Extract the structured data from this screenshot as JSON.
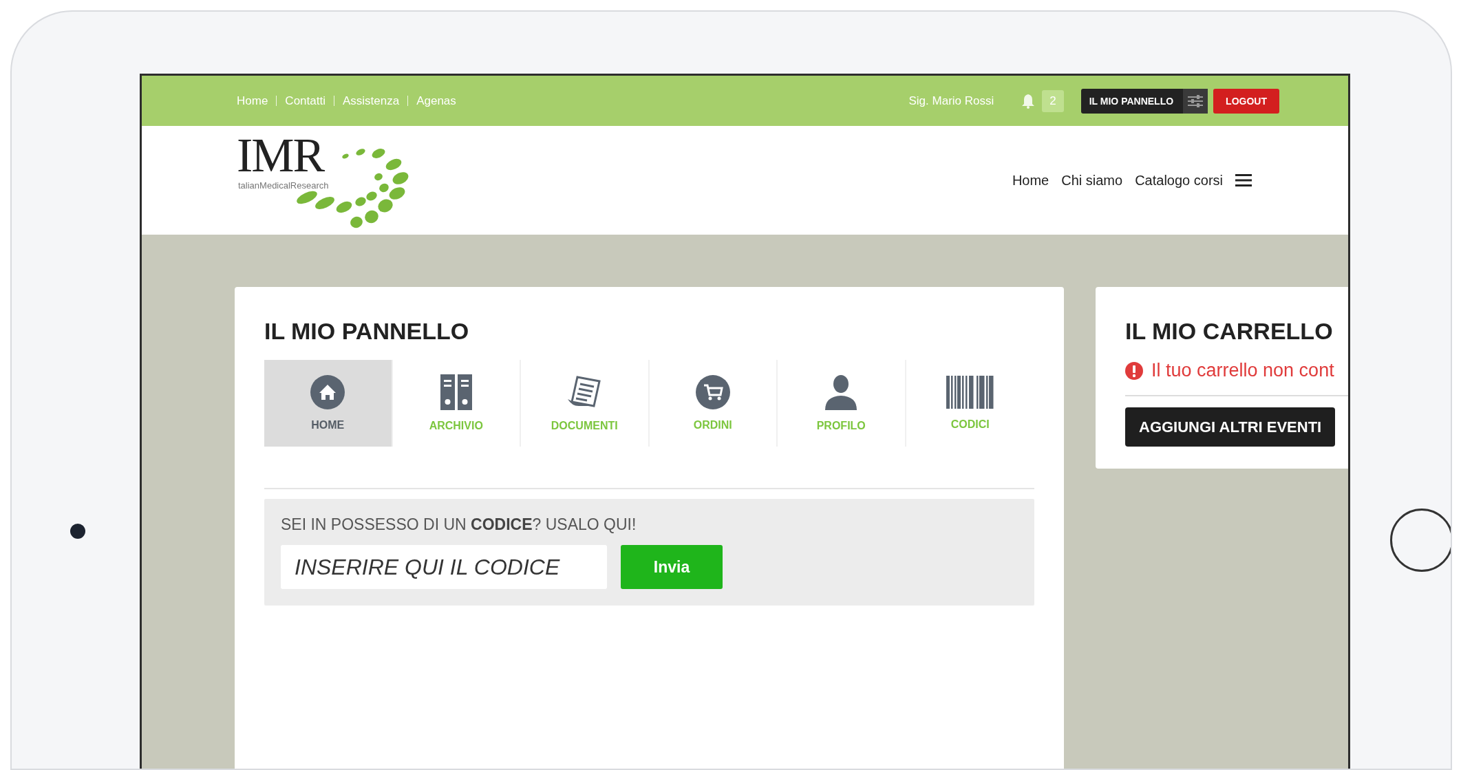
{
  "top_bar": {
    "links": [
      "Home",
      "Contatti",
      "Assistenza",
      "Agenas"
    ],
    "user_name": "Sig. Mario Rossi",
    "notifications": "2",
    "panel_button": "IL MIO PANNELLO",
    "logout_button": "LOGOUT"
  },
  "header": {
    "logo": {
      "title": "IMR",
      "subtitle": "talianMedicalResearch"
    },
    "nav": [
      "Home",
      "Chi siamo",
      "Catalogo corsi"
    ]
  },
  "panel": {
    "title": "IL MIO PANNELLO",
    "tabs": [
      {
        "label": "HOME",
        "kind": "home",
        "selected": true
      },
      {
        "label": "ARCHIVIO",
        "kind": "archive",
        "selected": false
      },
      {
        "label": "DOCUMENTI",
        "kind": "documents",
        "selected": false
      },
      {
        "label": "ORDINI",
        "kind": "orders",
        "selected": false
      },
      {
        "label": "PROFILO",
        "kind": "profile",
        "selected": false
      },
      {
        "label": "CODICI",
        "kind": "codes",
        "selected": false
      }
    ],
    "code_box": {
      "prompt": "SEI IN POSSESSO DI UN **CODICE**? USALO QUI!",
      "placeholder": "INSERIRE QUI IL CODICE",
      "button": "Invia"
    }
  },
  "cart": {
    "title": "IL MIO CARRELLO",
    "message": "Il tuo carrello non cont",
    "button": "AGGIUNGI ALTRI EVENTI"
  }
}
